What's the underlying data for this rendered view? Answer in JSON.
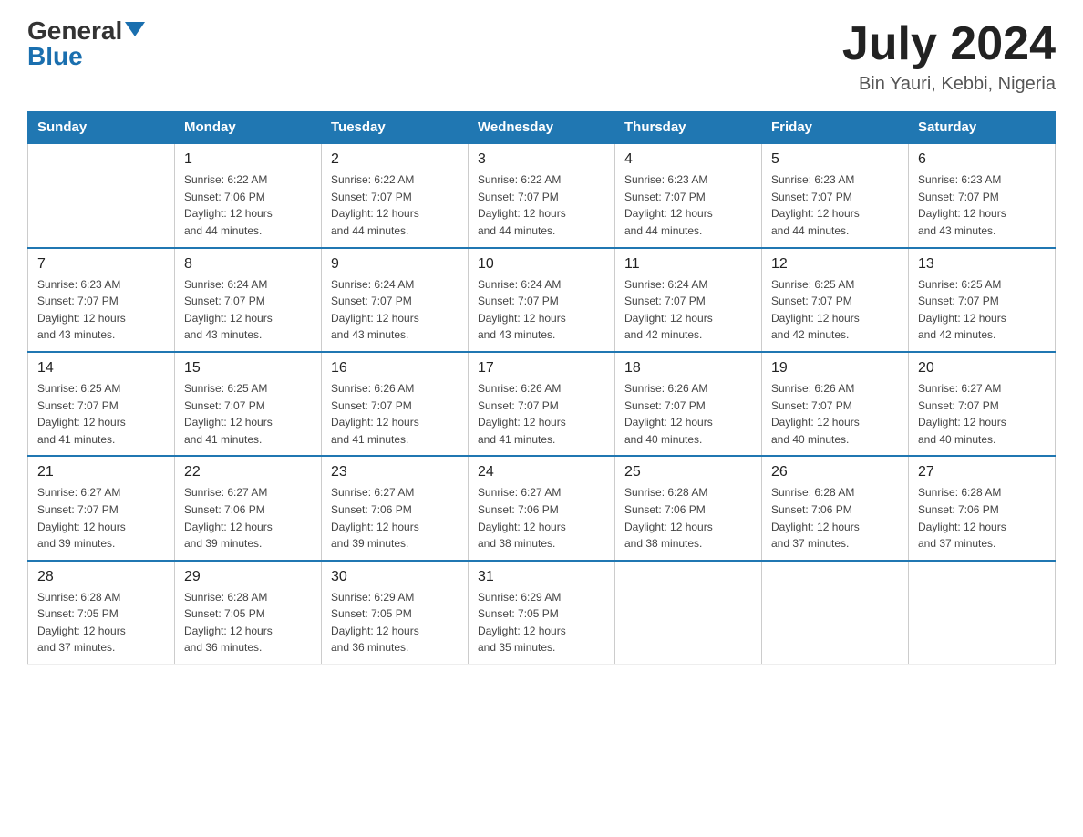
{
  "header": {
    "logo_general": "General",
    "logo_blue": "Blue",
    "month_title": "July 2024",
    "location": "Bin Yauri, Kebbi, Nigeria"
  },
  "days_of_week": [
    "Sunday",
    "Monday",
    "Tuesday",
    "Wednesday",
    "Thursday",
    "Friday",
    "Saturday"
  ],
  "weeks": [
    [
      {
        "day": "",
        "info": ""
      },
      {
        "day": "1",
        "info": "Sunrise: 6:22 AM\nSunset: 7:06 PM\nDaylight: 12 hours\nand 44 minutes."
      },
      {
        "day": "2",
        "info": "Sunrise: 6:22 AM\nSunset: 7:07 PM\nDaylight: 12 hours\nand 44 minutes."
      },
      {
        "day": "3",
        "info": "Sunrise: 6:22 AM\nSunset: 7:07 PM\nDaylight: 12 hours\nand 44 minutes."
      },
      {
        "day": "4",
        "info": "Sunrise: 6:23 AM\nSunset: 7:07 PM\nDaylight: 12 hours\nand 44 minutes."
      },
      {
        "day": "5",
        "info": "Sunrise: 6:23 AM\nSunset: 7:07 PM\nDaylight: 12 hours\nand 44 minutes."
      },
      {
        "day": "6",
        "info": "Sunrise: 6:23 AM\nSunset: 7:07 PM\nDaylight: 12 hours\nand 43 minutes."
      }
    ],
    [
      {
        "day": "7",
        "info": "Sunrise: 6:23 AM\nSunset: 7:07 PM\nDaylight: 12 hours\nand 43 minutes."
      },
      {
        "day": "8",
        "info": "Sunrise: 6:24 AM\nSunset: 7:07 PM\nDaylight: 12 hours\nand 43 minutes."
      },
      {
        "day": "9",
        "info": "Sunrise: 6:24 AM\nSunset: 7:07 PM\nDaylight: 12 hours\nand 43 minutes."
      },
      {
        "day": "10",
        "info": "Sunrise: 6:24 AM\nSunset: 7:07 PM\nDaylight: 12 hours\nand 43 minutes."
      },
      {
        "day": "11",
        "info": "Sunrise: 6:24 AM\nSunset: 7:07 PM\nDaylight: 12 hours\nand 42 minutes."
      },
      {
        "day": "12",
        "info": "Sunrise: 6:25 AM\nSunset: 7:07 PM\nDaylight: 12 hours\nand 42 minutes."
      },
      {
        "day": "13",
        "info": "Sunrise: 6:25 AM\nSunset: 7:07 PM\nDaylight: 12 hours\nand 42 minutes."
      }
    ],
    [
      {
        "day": "14",
        "info": "Sunrise: 6:25 AM\nSunset: 7:07 PM\nDaylight: 12 hours\nand 41 minutes."
      },
      {
        "day": "15",
        "info": "Sunrise: 6:25 AM\nSunset: 7:07 PM\nDaylight: 12 hours\nand 41 minutes."
      },
      {
        "day": "16",
        "info": "Sunrise: 6:26 AM\nSunset: 7:07 PM\nDaylight: 12 hours\nand 41 minutes."
      },
      {
        "day": "17",
        "info": "Sunrise: 6:26 AM\nSunset: 7:07 PM\nDaylight: 12 hours\nand 41 minutes."
      },
      {
        "day": "18",
        "info": "Sunrise: 6:26 AM\nSunset: 7:07 PM\nDaylight: 12 hours\nand 40 minutes."
      },
      {
        "day": "19",
        "info": "Sunrise: 6:26 AM\nSunset: 7:07 PM\nDaylight: 12 hours\nand 40 minutes."
      },
      {
        "day": "20",
        "info": "Sunrise: 6:27 AM\nSunset: 7:07 PM\nDaylight: 12 hours\nand 40 minutes."
      }
    ],
    [
      {
        "day": "21",
        "info": "Sunrise: 6:27 AM\nSunset: 7:07 PM\nDaylight: 12 hours\nand 39 minutes."
      },
      {
        "day": "22",
        "info": "Sunrise: 6:27 AM\nSunset: 7:06 PM\nDaylight: 12 hours\nand 39 minutes."
      },
      {
        "day": "23",
        "info": "Sunrise: 6:27 AM\nSunset: 7:06 PM\nDaylight: 12 hours\nand 39 minutes."
      },
      {
        "day": "24",
        "info": "Sunrise: 6:27 AM\nSunset: 7:06 PM\nDaylight: 12 hours\nand 38 minutes."
      },
      {
        "day": "25",
        "info": "Sunrise: 6:28 AM\nSunset: 7:06 PM\nDaylight: 12 hours\nand 38 minutes."
      },
      {
        "day": "26",
        "info": "Sunrise: 6:28 AM\nSunset: 7:06 PM\nDaylight: 12 hours\nand 37 minutes."
      },
      {
        "day": "27",
        "info": "Sunrise: 6:28 AM\nSunset: 7:06 PM\nDaylight: 12 hours\nand 37 minutes."
      }
    ],
    [
      {
        "day": "28",
        "info": "Sunrise: 6:28 AM\nSunset: 7:05 PM\nDaylight: 12 hours\nand 37 minutes."
      },
      {
        "day": "29",
        "info": "Sunrise: 6:28 AM\nSunset: 7:05 PM\nDaylight: 12 hours\nand 36 minutes."
      },
      {
        "day": "30",
        "info": "Sunrise: 6:29 AM\nSunset: 7:05 PM\nDaylight: 12 hours\nand 36 minutes."
      },
      {
        "day": "31",
        "info": "Sunrise: 6:29 AM\nSunset: 7:05 PM\nDaylight: 12 hours\nand 35 minutes."
      },
      {
        "day": "",
        "info": ""
      },
      {
        "day": "",
        "info": ""
      },
      {
        "day": "",
        "info": ""
      }
    ]
  ]
}
